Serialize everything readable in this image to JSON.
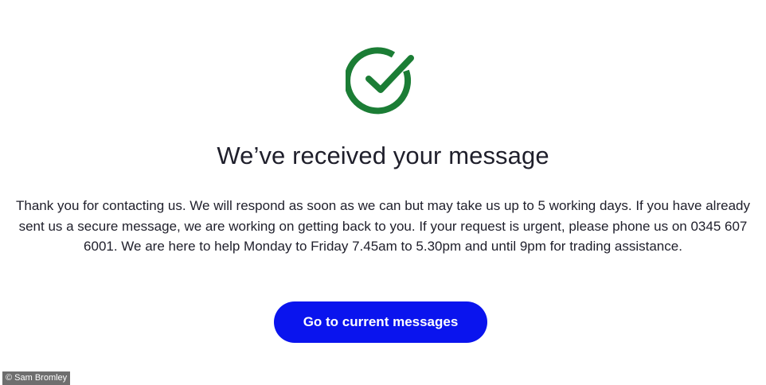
{
  "confirmation": {
    "icon": "check-circle-icon",
    "icon_color": "#1b7d35",
    "title": "We’ve received your message",
    "body": "Thank you for contacting us. We will respond as soon as we can but may take us up to 5 working days. If you have already sent us a secure message, we are working on getting back to you. If your request is urgent, please phone us on 0345 607 6001. We are here to help Monday to Friday 7.45am to 5.30pm and until 9pm for trading assistance.",
    "button_label": "Go to current messages",
    "button_color": "#0a14ee"
  },
  "credit": {
    "text": "© Sam Bromley"
  }
}
